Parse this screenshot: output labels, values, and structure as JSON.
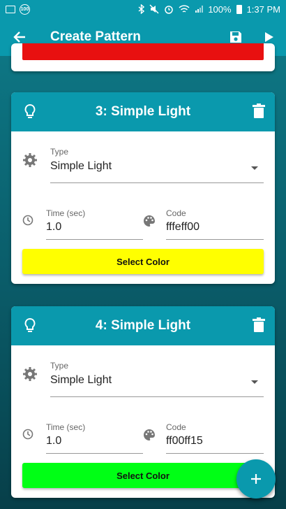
{
  "status_bar": {
    "battery": "100%",
    "time": "1:37 PM"
  },
  "app_bar": {
    "title": "Create Pattern",
    "icons": [
      "back-arrow-icon",
      "save-icon",
      "play-icon"
    ]
  },
  "top_card": {
    "color": "#e81010"
  },
  "cards": [
    {
      "title": "3: Simple Light",
      "type_label": "Type",
      "type_value": "Simple Light",
      "time_label": "Time (sec)",
      "time_value": "1.0",
      "code_label": "Code",
      "code_value": "fffeff00",
      "button_label": "Select Color",
      "button_color": "#ffff00"
    },
    {
      "title": "4: Simple Light",
      "type_label": "Type",
      "type_value": "Simple Light",
      "time_label": "Time (sec)",
      "time_value": "1.0",
      "code_label": "Code",
      "code_value": "ff00ff15",
      "button_label": "Select Color",
      "button_color": "#00ff15"
    }
  ],
  "fab": {
    "icon": "add-icon"
  },
  "colors": {
    "primary": "#0a99ad"
  }
}
